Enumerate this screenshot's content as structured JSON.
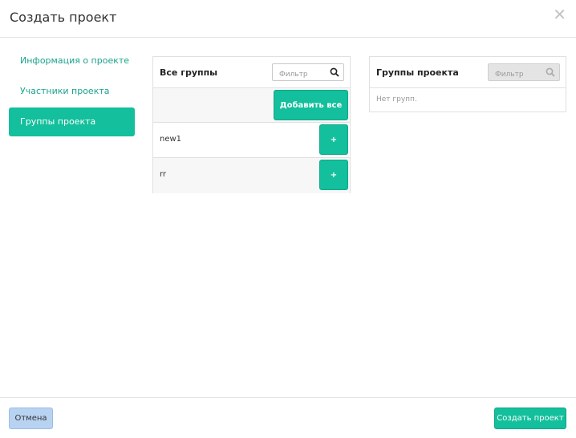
{
  "modal": {
    "title": "Создать проект",
    "close_icon": "close-icon"
  },
  "nav": {
    "items": [
      {
        "label": "Информация о проекте",
        "active": false
      },
      {
        "label": "Участники проекта",
        "active": false
      },
      {
        "label": "Группы проекта",
        "active": true
      }
    ]
  },
  "all_groups": {
    "title": "Все группы",
    "filter_placeholder": "Фильтр",
    "add_all_label": "Добавить все",
    "rows": [
      {
        "name": "new1",
        "action": "+"
      },
      {
        "name": "rr",
        "action": "+"
      }
    ]
  },
  "project_groups": {
    "title": "Группы проекта",
    "filter_placeholder": "Фильтр",
    "empty_text": "Нет групп."
  },
  "footer": {
    "cancel_label": "Отмена",
    "create_label": "Создать проект"
  },
  "colors": {
    "accent": "#13bf9c",
    "link": "#1aa38a",
    "cancel_bg": "#b8d3f2"
  }
}
